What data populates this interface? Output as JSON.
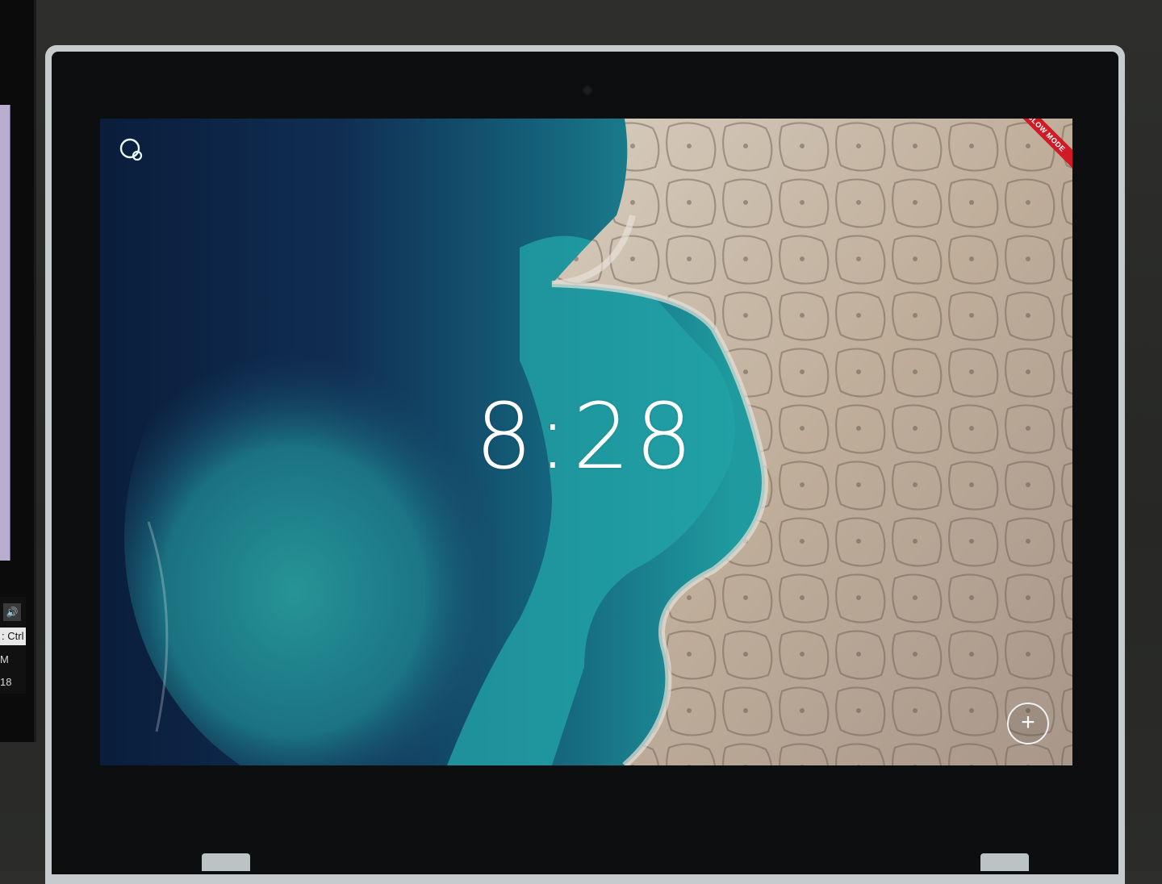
{
  "left_monitor": {
    "volume_icon": "speaker-icon",
    "ctrl_label": "Ctrl",
    "ctrl_prefix": ":",
    "time_fragment": "M",
    "date_fragment": "18"
  },
  "lockscreen": {
    "time": "8:28",
    "badge": "SLOW MODE",
    "assistant_icon": "assistant-icon",
    "add_icon": "plus-icon",
    "add_glyph": "+"
  },
  "colors": {
    "ribbon": "#d01a25",
    "ocean_deep": "#0b2140",
    "lagoon": "#1f9a9e",
    "land": "#c9bcac"
  }
}
